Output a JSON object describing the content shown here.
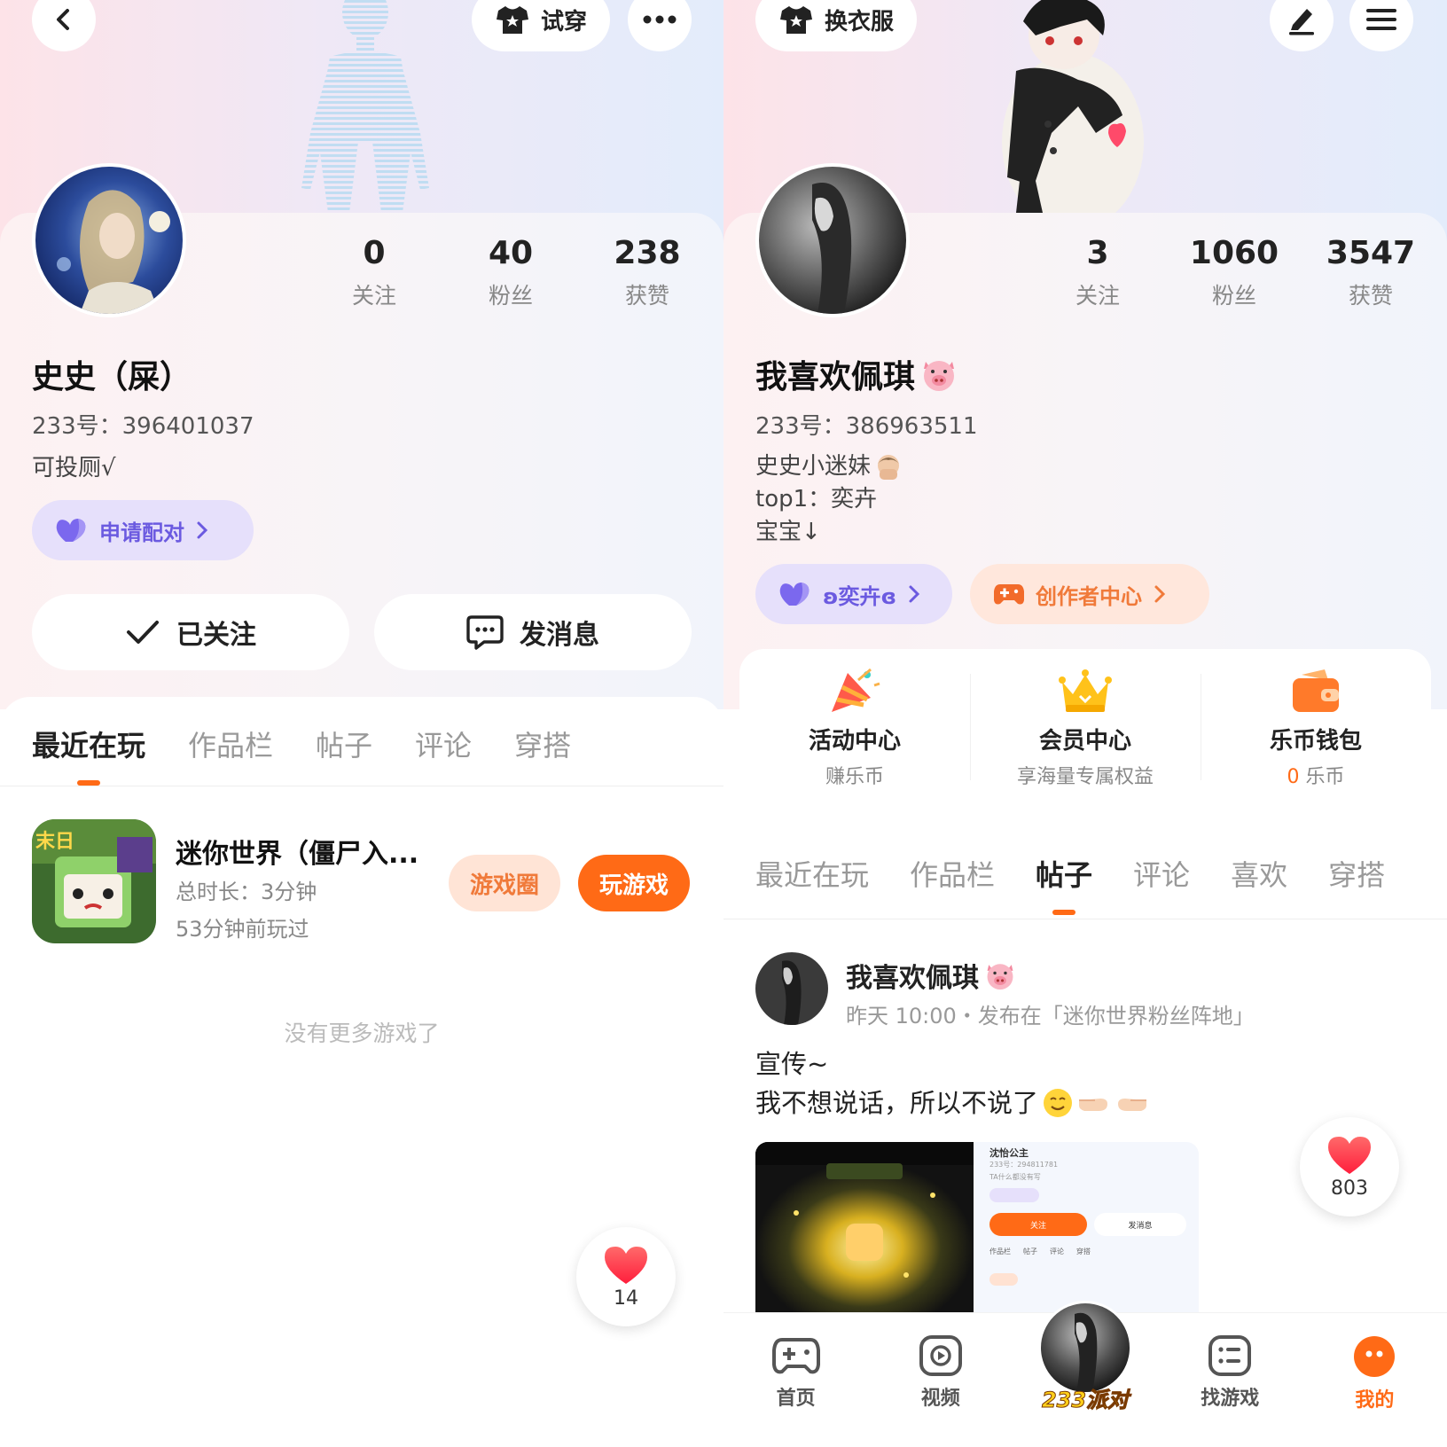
{
  "left": {
    "top_buttons": {
      "try_on_label": "试穿"
    },
    "profile": {
      "stats": [
        {
          "value": "0",
          "label": "关注"
        },
        {
          "value": "40",
          "label": "粉丝"
        },
        {
          "value": "238",
          "label": "获赞"
        }
      ],
      "name": "史史（屎）",
      "id_line": "233号：396401037",
      "bio": "可投厕√",
      "pair_tag": "申请配对"
    },
    "actions": {
      "follow_label": "已关注",
      "message_label": "发消息"
    },
    "tabs": [
      {
        "label": "最近在玩",
        "active": true
      },
      {
        "label": "作品栏",
        "active": false
      },
      {
        "label": "帖子",
        "active": false
      },
      {
        "label": "评论",
        "active": false
      },
      {
        "label": "穿搭",
        "active": false
      }
    ],
    "game": {
      "title": "迷你世界（僵尸入...",
      "duration": "总时长：3分钟",
      "last_played": "53分钟前玩过",
      "circle_button": "游戏圈",
      "play_button": "玩游戏"
    },
    "no_more_text": "没有更多游戏了",
    "like_count": "14"
  },
  "right": {
    "top_buttons": {
      "outfit_label": "换衣服"
    },
    "profile": {
      "stats": [
        {
          "value": "3",
          "label": "关注"
        },
        {
          "value": "1060",
          "label": "粉丝"
        },
        {
          "value": "3547",
          "label": "获赞"
        }
      ],
      "name": "我喜欢佩琪",
      "id_line": "233号：386963511",
      "bio_lines": [
        "史史小迷妹",
        "top1：奕卉",
        "宝宝↓"
      ],
      "pair_tag": "ʚ奕卉ɞ",
      "creator_tag": "创作者中心"
    },
    "services": [
      {
        "title": "活动中心",
        "sub": "赚乐币"
      },
      {
        "title": "会员中心",
        "sub": "享海量专属权益"
      },
      {
        "title": "乐币钱包",
        "sub_value": "0",
        "sub": "乐币"
      }
    ],
    "tabs": [
      {
        "label": "最近在玩",
        "active": false
      },
      {
        "label": "作品栏",
        "active": false
      },
      {
        "label": "帖子",
        "active": true
      },
      {
        "label": "评论",
        "active": false
      },
      {
        "label": "喜欢",
        "active": false
      },
      {
        "label": "穿搭",
        "active": false
      }
    ],
    "post": {
      "author": "我喜欢佩琪",
      "meta": "昨天 10:00・发布在「迷你世界粉丝阵地」",
      "line1": "宣传~",
      "line2": "我不想说话，所以不说了",
      "thumb_name": "沈怡公主",
      "thumb_id": "233号：294811781",
      "thumb_bio": "TA什么都没有写",
      "thumb_follow": "关注",
      "thumb_message": "发消息",
      "thumb_tabs": [
        "作品栏",
        "帖子",
        "评论",
        "穿搭"
      ]
    },
    "like_count": "803",
    "nav": [
      {
        "label": "首页",
        "active": false
      },
      {
        "label": "视频",
        "active": false
      },
      {
        "label": "233派对",
        "active": false
      },
      {
        "label": "找游戏",
        "active": false
      },
      {
        "label": "我的",
        "active": true
      }
    ]
  },
  "colors": {
    "accent": "#ff6a16",
    "purple": "#6b5ae0",
    "heart": "#ff3b4a"
  }
}
